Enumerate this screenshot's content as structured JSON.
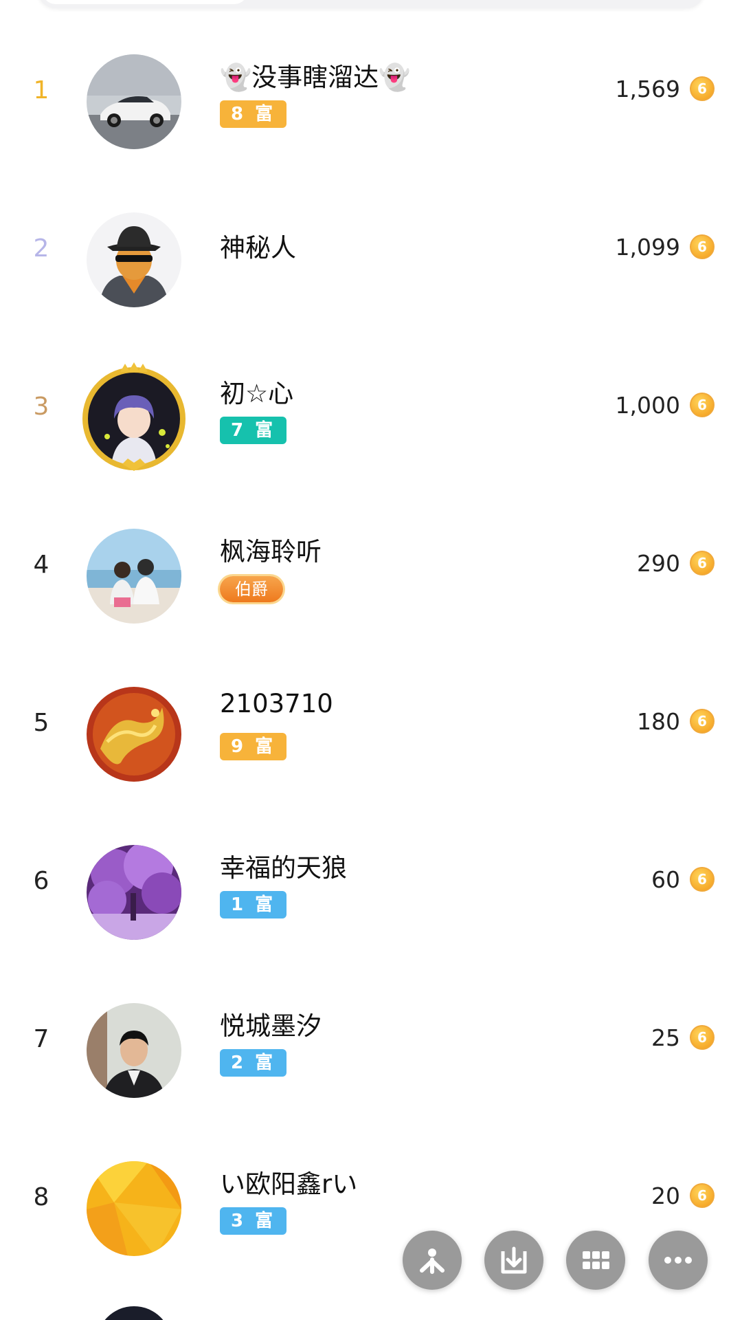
{
  "colors": {
    "rank1": "#f0b429",
    "rank2": "#b6b5e8",
    "rank3": "#c99a62",
    "default_rank": "#222222",
    "badge_orange": "#f7b33a",
    "badge_teal": "#16c1ad",
    "badge_blue": "#4fb5ef",
    "coin": "#f39a19",
    "fab": "#9a9a9a"
  },
  "ranking": [
    {
      "rank": "1",
      "name": "👻没事瞎溜达👻",
      "badge": "8 富",
      "badge_color": "orange",
      "points": "1,569",
      "avatar": "car"
    },
    {
      "rank": "2",
      "name": "神秘人",
      "badge": "",
      "badge_color": "",
      "points": "1,099",
      "avatar": "mystery-man"
    },
    {
      "rank": "3",
      "name": "初☆心",
      "badge": "7 富",
      "badge_color": "teal",
      "points": "1,000",
      "avatar": "anime-boy"
    },
    {
      "rank": "4",
      "name": "枫海聆听",
      "badge": "伯爵",
      "badge_color": "title",
      "points": "290",
      "avatar": "couple-beach"
    },
    {
      "rank": "5",
      "name": "2103710",
      "badge": "9 富",
      "badge_color": "orange",
      "points": "180",
      "avatar": "golden-dragon"
    },
    {
      "rank": "6",
      "name": "幸福的天狼",
      "badge": "1 富",
      "badge_color": "blue",
      "points": "60",
      "avatar": "purple-tree"
    },
    {
      "rank": "7",
      "name": "悦城墨汐",
      "badge": "2 富",
      "badge_color": "blue",
      "points": "25",
      "avatar": "man-portrait"
    },
    {
      "rank": "8",
      "name": "い欧阳鑫rい",
      "badge": "3 富",
      "badge_color": "blue",
      "points": "20",
      "avatar": "yellow-abstract"
    }
  ],
  "coin_glyph": "6",
  "fabs": [
    "share-icon",
    "download-icon",
    "grid-icon",
    "more-icon"
  ]
}
